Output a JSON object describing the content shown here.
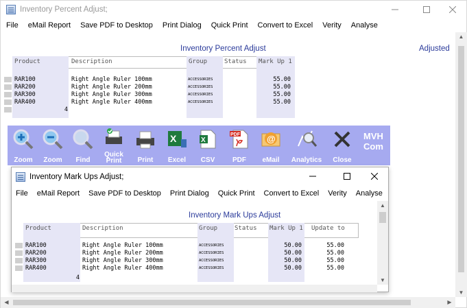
{
  "outer": {
    "title": "Inventory Percent Adjust;",
    "menu": [
      "File",
      "eMail Report",
      "Save PDF to Desktop",
      "Print Dialog",
      "Quick Print",
      "Convert to Excel",
      "Verity",
      "Analyse"
    ],
    "report_title": "Inventory Percent Adjust",
    "status_label": "Adjusted",
    "columns": [
      "Product",
      "Description",
      "Group",
      "Status",
      "Mark Up 1"
    ],
    "rows": [
      {
        "product": "RAR100",
        "description": "Right Angle Ruler 100mm",
        "group": "ACCESSORIES",
        "status": "",
        "markup1": "55.00"
      },
      {
        "product": "RAR200",
        "description": "Right Angle Ruler 200mm",
        "group": "ACCESSORIES",
        "status": "",
        "markup1": "55.00"
      },
      {
        "product": "RAR300",
        "description": "Right Angle Ruler 300mm",
        "group": "ACCESSORIES",
        "status": "",
        "markup1": "55.00"
      },
      {
        "product": "RAR400",
        "description": "Right Angle Ruler 400mm",
        "group": "ACCESSORIES",
        "status": "",
        "markup1": "55.00"
      }
    ],
    "count": "4"
  },
  "toolbar": {
    "buttons": [
      {
        "label": "Zoom",
        "icon": "zoom-in-icon"
      },
      {
        "label": "Zoom",
        "icon": "zoom-out-icon"
      },
      {
        "label": "Find",
        "icon": "find-icon"
      },
      {
        "label": "Quick Print",
        "icon": "quick-print-icon"
      },
      {
        "label": "Print",
        "icon": "printer-icon"
      },
      {
        "label": "Excel",
        "icon": "excel-icon"
      },
      {
        "label": "CSV",
        "icon": "csv-icon"
      },
      {
        "label": "PDF",
        "icon": "pdf-icon"
      },
      {
        "label": "eMail",
        "icon": "email-icon"
      },
      {
        "label": "Analytics",
        "icon": "analytics-icon"
      },
      {
        "label": "Close",
        "icon": "close-x-icon"
      }
    ],
    "brand": "MVH Com",
    "bg_color": "#a6aaf0"
  },
  "inner": {
    "title": "Inventory Mark Ups Adjust;",
    "menu": [
      "File",
      "eMail Report",
      "Save PDF to Desktop",
      "Print Dialog",
      "Quick Print",
      "Convert to Excel",
      "Verity",
      "Analyse"
    ],
    "report_title": "Inventory Mark Ups Adjust",
    "columns": [
      "Product",
      "Description",
      "Group",
      "Status",
      "Mark Up 1",
      "Update to"
    ],
    "rows": [
      {
        "product": "RAR100",
        "description": "Right Angle Ruler 100mm",
        "group": "ACCESSORIES",
        "status": "",
        "markup1": "50.00",
        "update_to": "55.00"
      },
      {
        "product": "RAR200",
        "description": "Right Angle Ruler 200mm",
        "group": "ACCESSORIES",
        "status": "",
        "markup1": "50.00",
        "update_to": "55.00"
      },
      {
        "product": "RAR300",
        "description": "Right Angle Ruler 300mm",
        "group": "ACCESSORIES",
        "status": "",
        "markup1": "50.00",
        "update_to": "55.00"
      },
      {
        "product": "RAR400",
        "description": "Right Angle Ruler 400mm",
        "group": "ACCESSORIES",
        "status": "",
        "markup1": "50.00",
        "update_to": "55.00"
      }
    ],
    "count": "4"
  }
}
